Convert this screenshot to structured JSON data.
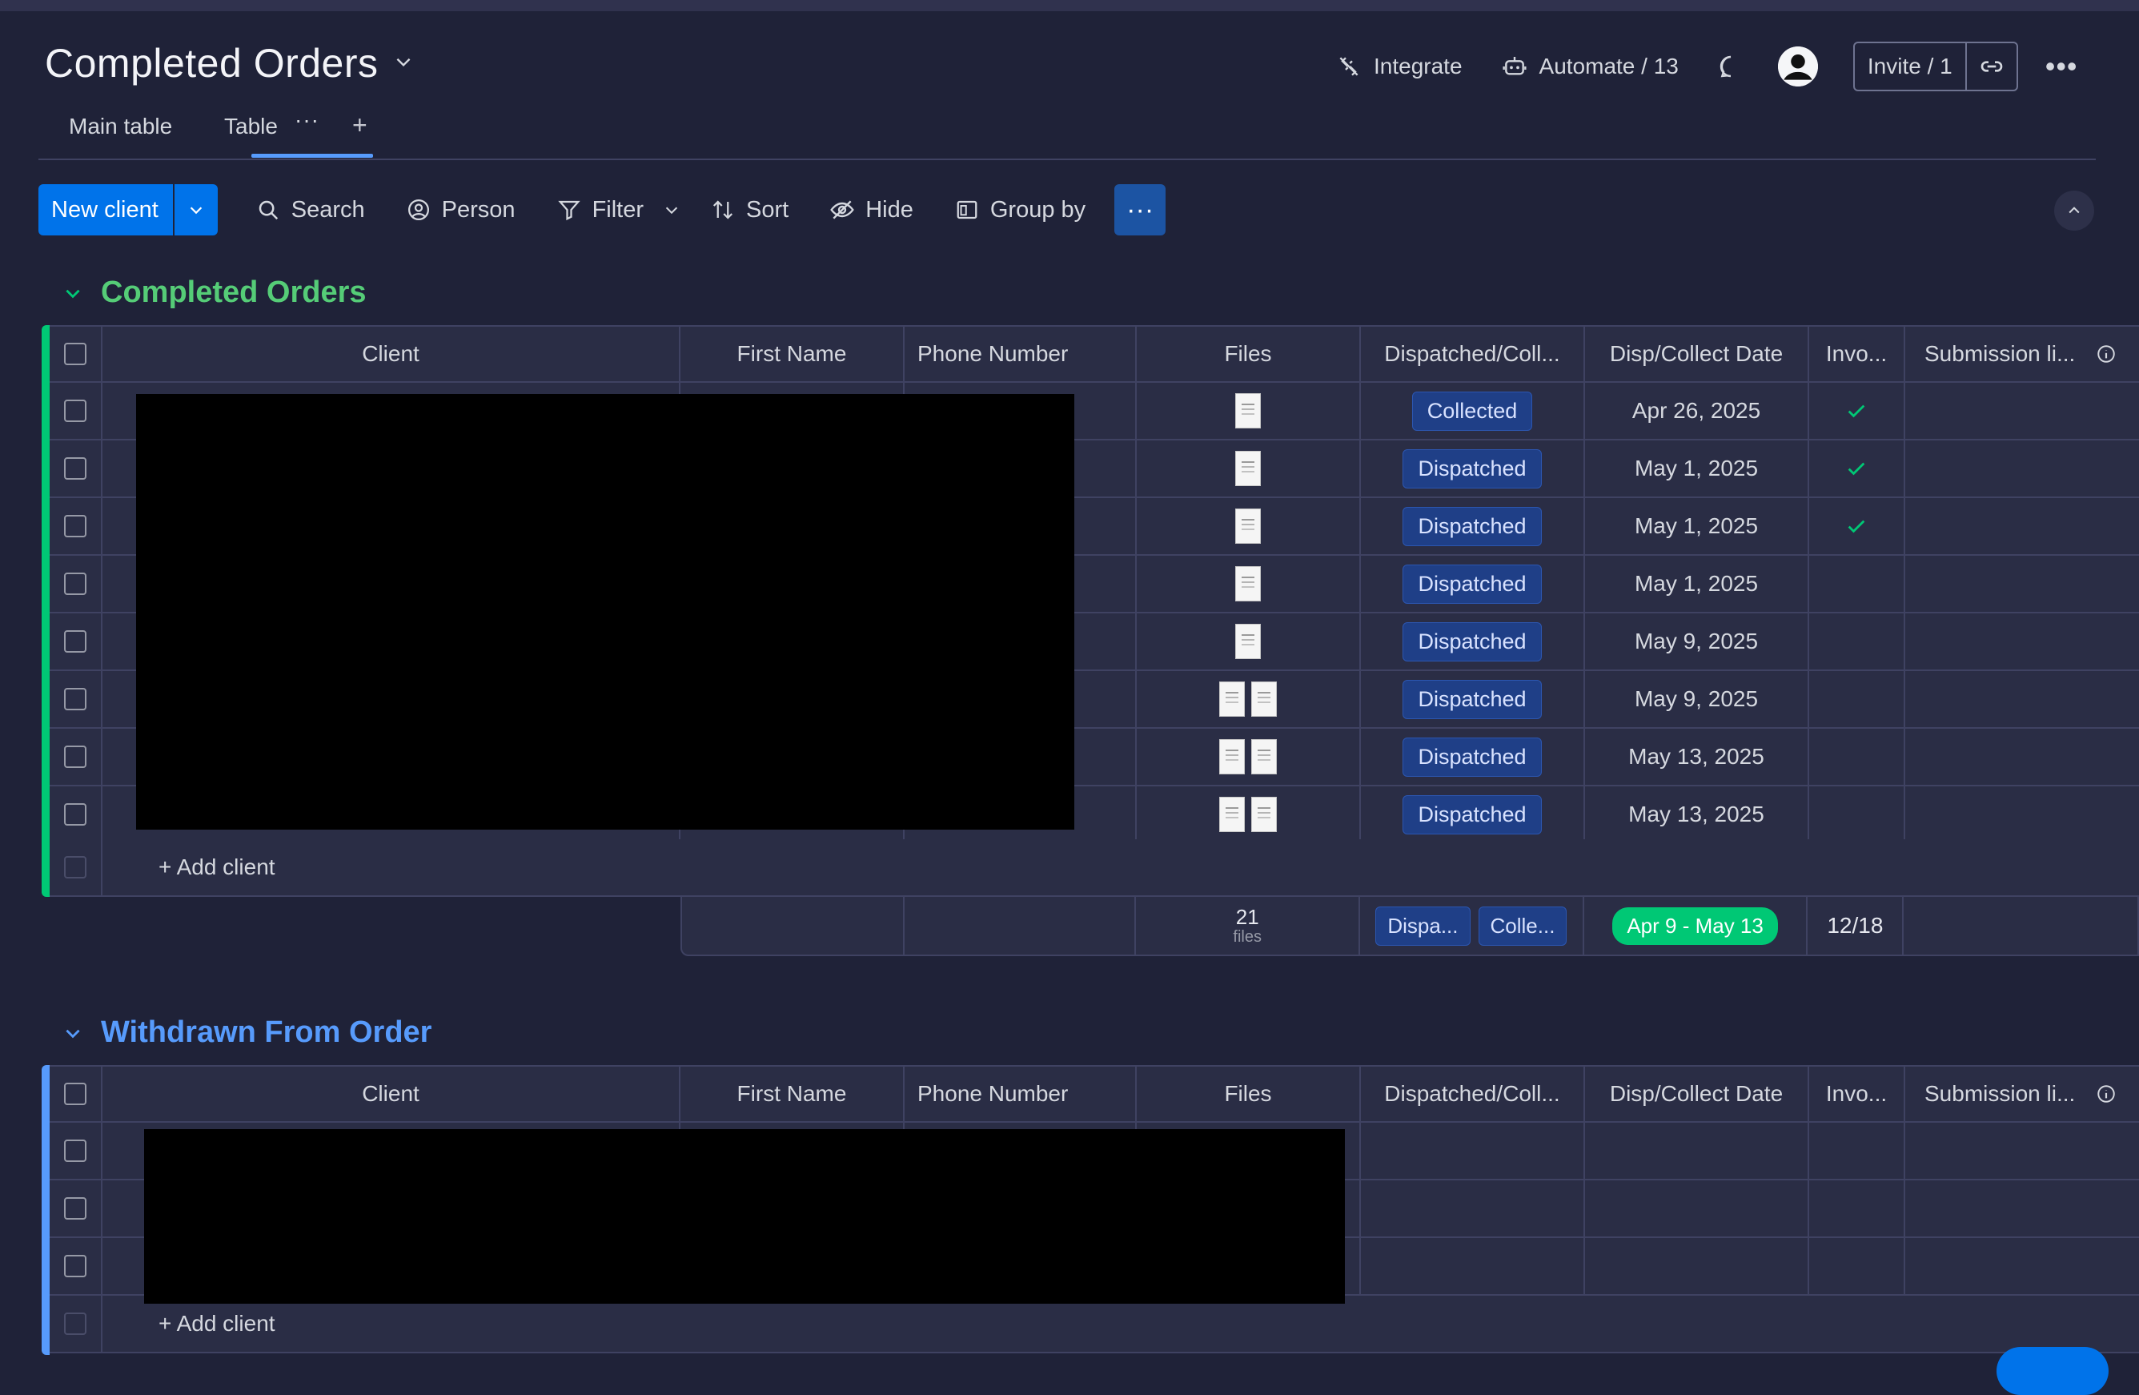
{
  "board": {
    "title": "Completed Orders"
  },
  "header": {
    "integrate": "Integrate",
    "automate": "Automate / 13",
    "invite": "Invite / 1"
  },
  "tabs": [
    {
      "label": "Main table"
    },
    {
      "label": "Table"
    }
  ],
  "toolbar": {
    "new_client": "New client",
    "search": "Search",
    "person": "Person",
    "filter": "Filter",
    "sort": "Sort",
    "hide": "Hide",
    "group_by": "Group by"
  },
  "columns": {
    "client": "Client",
    "first_name": "First Name",
    "phone": "Phone Number",
    "files": "Files",
    "dispatched": "Dispatched/Coll...",
    "date": "Disp/Collect Date",
    "invoice": "Invo...",
    "submission": "Submission li..."
  },
  "groups": [
    {
      "title": "Completed Orders",
      "color": "#00c875",
      "add_label": "+ Add client",
      "rows": [
        {
          "status": "Collected",
          "date": "Apr 26, 2025",
          "invoiced": true,
          "files": 1
        },
        {
          "status": "Dispatched",
          "date": "May 1, 2025",
          "invoiced": true,
          "files": 1
        },
        {
          "status": "Dispatched",
          "date": "May 1, 2025",
          "invoiced": true,
          "files": 1
        },
        {
          "status": "Dispatched",
          "date": "May 1, 2025",
          "invoiced": false,
          "files": 1
        },
        {
          "status": "Dispatched",
          "date": "May 9, 2025",
          "invoiced": false,
          "files": 1
        },
        {
          "status": "Dispatched",
          "date": "May 9, 2025",
          "invoiced": false,
          "files": 2
        },
        {
          "status": "Dispatched",
          "date": "May 13, 2025",
          "invoiced": false,
          "files": 2
        },
        {
          "status": "Dispatched",
          "date": "May 13, 2025",
          "invoiced": false,
          "files": 2
        }
      ],
      "summary": {
        "files_count": "21",
        "files_unit": "files",
        "status_chips": [
          "Dispa...",
          "Colle..."
        ],
        "date_range": "Apr 9 - May 13",
        "invoice": "12/18"
      }
    },
    {
      "title": "Withdrawn From Order",
      "color": "#579bfc",
      "add_label": "+ Add client",
      "row_count": 3
    }
  ],
  "colors": {
    "background": "#1f2238",
    "primary": "#0073ea",
    "status_blue": "#1f3f87",
    "done_green": "#00c875"
  }
}
